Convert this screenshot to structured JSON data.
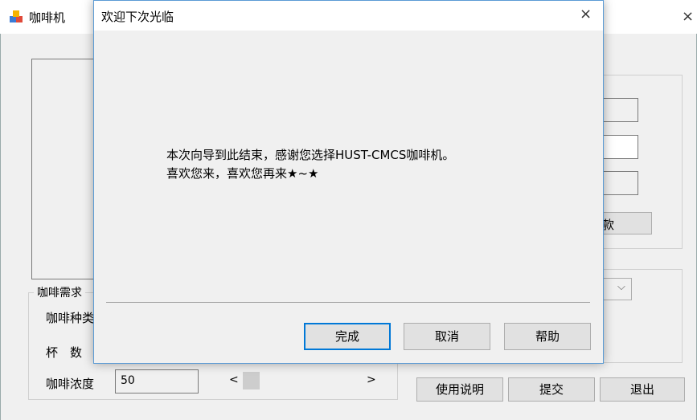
{
  "main_window": {
    "title": "咖啡机",
    "close_glyph": "×",
    "group_title": "咖啡需求",
    "coffee_type_label": "咖啡种类",
    "cups_label": "杯　数",
    "strength_label": "咖啡浓度",
    "strength_value": "50",
    "slider_left_glyph": "<",
    "slider_right_glyph": ">",
    "withdraw_label_partial": "退款",
    "combo_arrow": "⌵",
    "buttons": {
      "instructions": "使用说明",
      "submit": "提交",
      "exit": "退出"
    }
  },
  "dialog": {
    "title": "欢迎下次光临",
    "close_glyph": "×",
    "message_line1": "本次向导到此结束，感谢您选择HUST-CMCS咖啡机。",
    "message_line2": "喜欢您来，喜欢您再来★~★",
    "buttons": {
      "finish": "完成",
      "cancel": "取消",
      "help": "帮助"
    }
  },
  "colors": {
    "background": "#f0f0f0",
    "titlebar": "#ffffff",
    "dialog_border": "#5b9bd5",
    "default_button_focus": "#0078d7"
  }
}
